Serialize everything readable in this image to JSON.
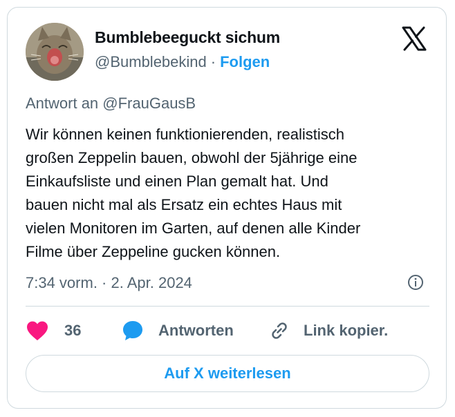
{
  "author": {
    "display_name": "Bumblebeeguckt sichum",
    "handle": "@Bumblebekind",
    "separator": "·",
    "follow_label": "Folgen"
  },
  "tweet": {
    "reply_to": "Antwort an @FrauGausB",
    "text": "Wir können keinen funktionierenden, realistisch\ngroßen Zeppelin bauen, obwohl der 5jährige eine\nEinkaufsliste und einen Plan gemalt hat. Und\nbauen nicht mal als Ersatz ein echtes Haus mit\nvielen Monitoren im Garten, auf denen alle Kinder\nFilme über Zeppeline gucken können.",
    "timestamp": "7:34 vorm. · 2. Apr. 2024"
  },
  "actions": {
    "like_count": "36",
    "reply_label": "Antworten",
    "copy_link_label": "Link kopier."
  },
  "read_more_label": "Auf X weiterlesen",
  "colors": {
    "like": "#f91880",
    "reply": "#1d9bf0",
    "link": "#1d9bf0",
    "muted": "#536471",
    "border": "#cfd9de"
  },
  "icons": {
    "logo": "x-logo-icon",
    "info": "info-icon",
    "like": "heart-icon",
    "reply": "speech-bubble-icon",
    "copy_link": "link-icon"
  }
}
